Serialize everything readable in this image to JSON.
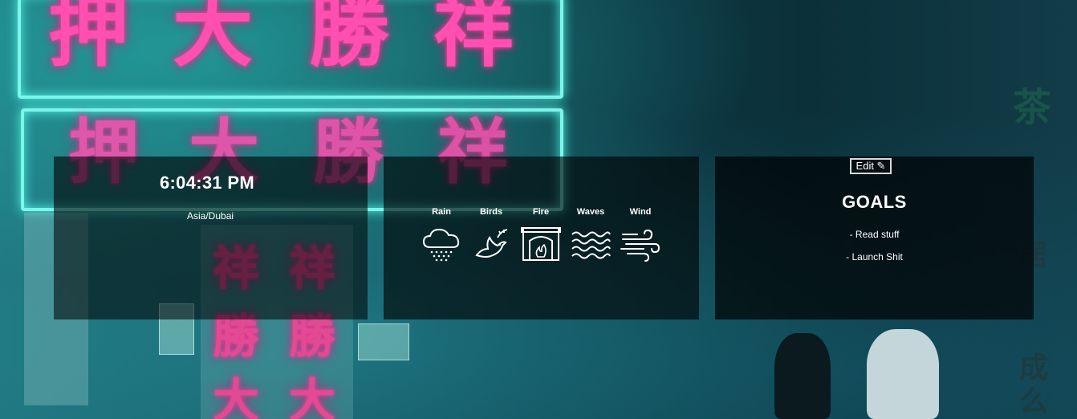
{
  "clock": {
    "time": "6:04:31 PM",
    "timezone": "Asia/Dubai"
  },
  "sounds": [
    {
      "label": "Rain",
      "icon": "rain-cloud-icon"
    },
    {
      "label": "Birds",
      "icon": "dove-icon"
    },
    {
      "label": "Fire",
      "icon": "fireplace-icon"
    },
    {
      "label": "Waves",
      "icon": "waves-icon"
    },
    {
      "label": "Wind",
      "icon": "wind-icon"
    }
  ],
  "goals": {
    "edit_label": "Edit ✎",
    "title": "GOALS",
    "items": [
      "- Read stuff",
      "- Launch Shit"
    ]
  },
  "background": {
    "neon_top": [
      "押",
      "大",
      "勝",
      "祥"
    ],
    "neon_mid": [
      "押",
      "大",
      "勝",
      "祥"
    ],
    "door_chars": [
      "祥",
      "祥",
      "勝",
      "勝",
      "大",
      "大"
    ],
    "side_chars": [
      "茶",
      "居",
      "成",
      "么"
    ]
  },
  "colors": {
    "neon_pink": "#ff4fb0",
    "neon_cyan": "#7ef5ea"
  }
}
